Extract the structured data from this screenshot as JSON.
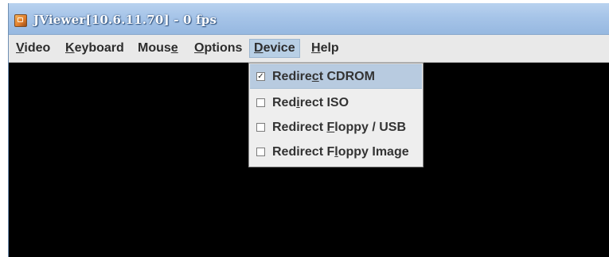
{
  "window": {
    "title": "JViewer[10.6.11.70] - 0 fps",
    "icon": "java-app-icon"
  },
  "menubar": {
    "items": [
      {
        "pre": "",
        "key": "V",
        "post": "ideo"
      },
      {
        "pre": "",
        "key": "K",
        "post": "eyboard"
      },
      {
        "pre": "Mous",
        "key": "e",
        "post": ""
      },
      {
        "pre": "",
        "key": "O",
        "post": "ptions"
      },
      {
        "pre": "",
        "key": "D",
        "post": "evice"
      },
      {
        "pre": "",
        "key": "H",
        "post": "elp"
      }
    ],
    "active_index": 4
  },
  "device_menu": {
    "items": [
      {
        "pre": "Redire",
        "key": "c",
        "post": "t CDROM",
        "checked": true,
        "check_mark": "✓"
      },
      {
        "pre": "Red",
        "key": "i",
        "post": "rect ISO",
        "checked": false,
        "check_mark": ""
      },
      {
        "pre": "Redirect ",
        "key": "F",
        "post": "loppy / USB",
        "checked": false,
        "check_mark": ""
      },
      {
        "pre": "Redirect F",
        "key": "l",
        "post": "oppy Image",
        "checked": false,
        "check_mark": ""
      }
    ],
    "highlight_index": 0
  },
  "colors": {
    "titlebar": "#a6c4e8",
    "menubar": "#e9e9e9",
    "menu_highlight": "#b8cfe5",
    "screen": "#000000"
  }
}
